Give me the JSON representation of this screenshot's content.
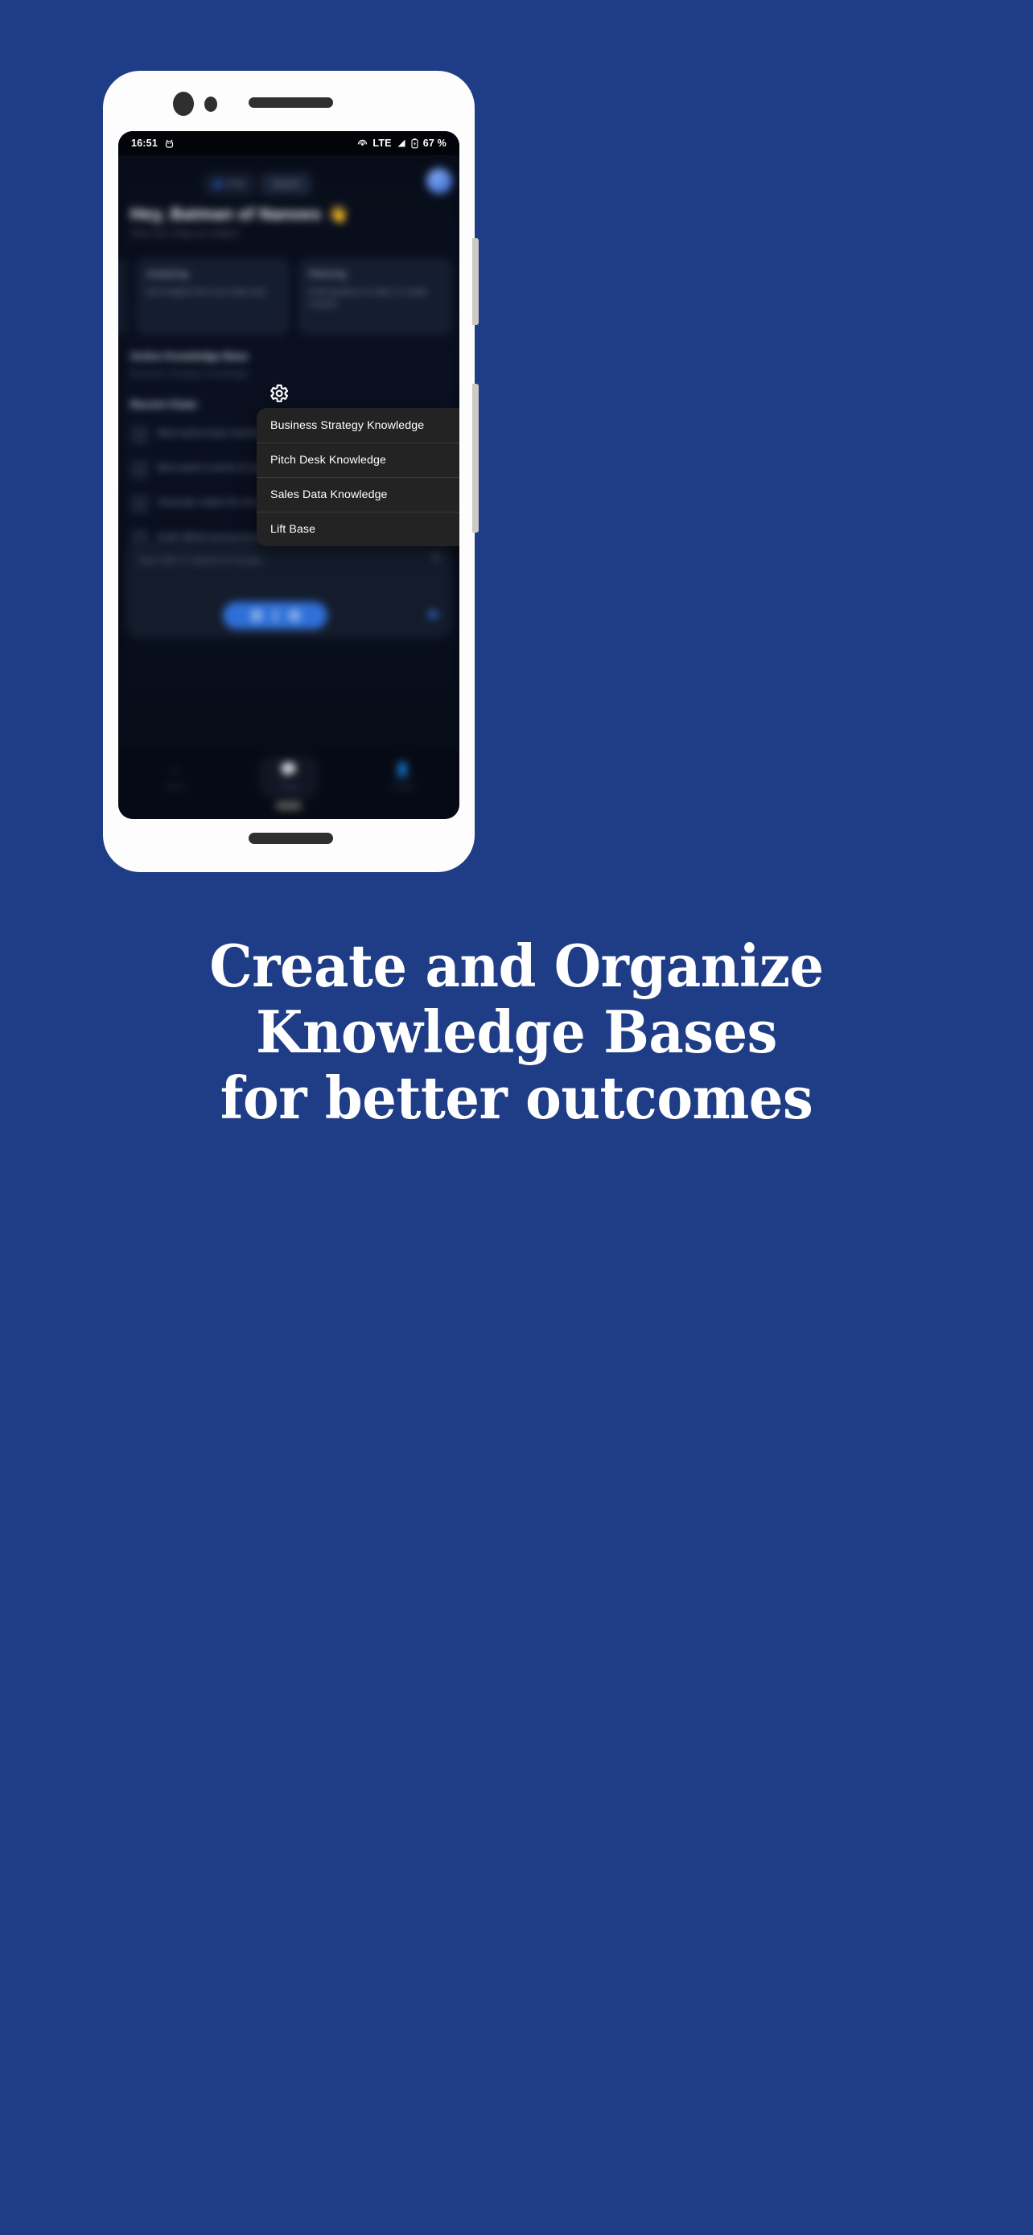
{
  "background_color": "#1f3c86",
  "headline": {
    "line1": "Create and Organize",
    "line2": "Knowledge Bases",
    "line3": "for better outcomes"
  },
  "phone": {
    "status_bar": {
      "time": "16:51",
      "android_icon": "android-debug-icon",
      "cast_icon": "cast-icon",
      "network": "LTE",
      "signal_icon": "signal-icon",
      "battery_icon": "battery-charging-icon",
      "battery_level": "67 %"
    },
    "app": {
      "top_tabs": [
        {
          "label": "Chat",
          "icon": "chat-icon"
        },
        {
          "label": "Search",
          "icon": "search-icon"
        }
      ],
      "avatar": "user-avatar",
      "greeting": "Hey, Batman of Nanoes",
      "greeting_emoji": "👋",
      "greeting_sub": "How can I help you today?",
      "cards": [
        {
          "title": "Analyzing",
          "body": "Get insights from your data sets."
        },
        {
          "title": "Planning",
          "body": "Draft guidance to plan or create content."
        }
      ],
      "active_kb_title": "Active Knowledge Base",
      "active_kb_sub": "Business Strategy Knowledge",
      "recent_title": "Recent Chats",
      "recent_more": "›",
      "recent_chats": [
        "Most active team member based on activity",
        "Best week in terms of sales",
        "Generate outline for new project",
        "Draft official announcement"
      ],
      "composer_placeholder": "Type talk or upload an image...",
      "attach_icon": "paperclip-icon",
      "send_icon": "send-icon",
      "mic_pill_icons": [
        "stop-icon",
        "waveform-icon",
        "mic-icon"
      ],
      "nav_items": [
        {
          "label": "Home",
          "icon": "home-icon"
        },
        {
          "label": "Chats",
          "icon": "chat-bubble-icon"
        },
        {
          "label": "Profile",
          "icon": "person-icon"
        }
      ]
    },
    "settings_icon": "gear-icon",
    "dropdown_menu": {
      "items": [
        "Business Strategy Knowledge",
        "Pitch Desk Knowledge",
        "Sales Data Knowledge",
        "Lift Base"
      ]
    }
  }
}
